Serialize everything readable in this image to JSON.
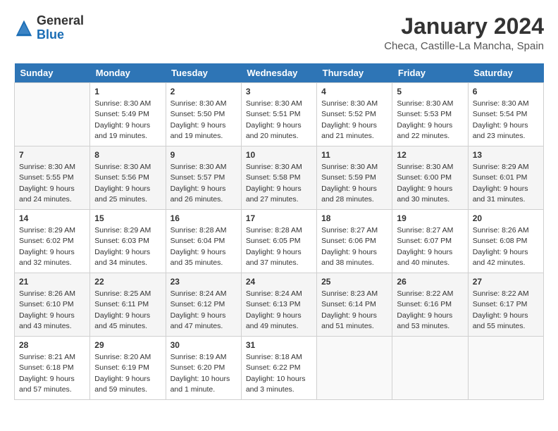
{
  "header": {
    "logo_general": "General",
    "logo_blue": "Blue",
    "month_year": "January 2024",
    "location": "Checa, Castille-La Mancha, Spain"
  },
  "weekdays": [
    "Sunday",
    "Monday",
    "Tuesday",
    "Wednesday",
    "Thursday",
    "Friday",
    "Saturday"
  ],
  "weeks": [
    [
      {
        "day": "",
        "info": ""
      },
      {
        "day": "1",
        "info": "Sunrise: 8:30 AM\nSunset: 5:49 PM\nDaylight: 9 hours\nand 19 minutes."
      },
      {
        "day": "2",
        "info": "Sunrise: 8:30 AM\nSunset: 5:50 PM\nDaylight: 9 hours\nand 19 minutes."
      },
      {
        "day": "3",
        "info": "Sunrise: 8:30 AM\nSunset: 5:51 PM\nDaylight: 9 hours\nand 20 minutes."
      },
      {
        "day": "4",
        "info": "Sunrise: 8:30 AM\nSunset: 5:52 PM\nDaylight: 9 hours\nand 21 minutes."
      },
      {
        "day": "5",
        "info": "Sunrise: 8:30 AM\nSunset: 5:53 PM\nDaylight: 9 hours\nand 22 minutes."
      },
      {
        "day": "6",
        "info": "Sunrise: 8:30 AM\nSunset: 5:54 PM\nDaylight: 9 hours\nand 23 minutes."
      }
    ],
    [
      {
        "day": "7",
        "info": "Sunrise: 8:30 AM\nSunset: 5:55 PM\nDaylight: 9 hours\nand 24 minutes."
      },
      {
        "day": "8",
        "info": "Sunrise: 8:30 AM\nSunset: 5:56 PM\nDaylight: 9 hours\nand 25 minutes."
      },
      {
        "day": "9",
        "info": "Sunrise: 8:30 AM\nSunset: 5:57 PM\nDaylight: 9 hours\nand 26 minutes."
      },
      {
        "day": "10",
        "info": "Sunrise: 8:30 AM\nSunset: 5:58 PM\nDaylight: 9 hours\nand 27 minutes."
      },
      {
        "day": "11",
        "info": "Sunrise: 8:30 AM\nSunset: 5:59 PM\nDaylight: 9 hours\nand 28 minutes."
      },
      {
        "day": "12",
        "info": "Sunrise: 8:30 AM\nSunset: 6:00 PM\nDaylight: 9 hours\nand 30 minutes."
      },
      {
        "day": "13",
        "info": "Sunrise: 8:29 AM\nSunset: 6:01 PM\nDaylight: 9 hours\nand 31 minutes."
      }
    ],
    [
      {
        "day": "14",
        "info": "Sunrise: 8:29 AM\nSunset: 6:02 PM\nDaylight: 9 hours\nand 32 minutes."
      },
      {
        "day": "15",
        "info": "Sunrise: 8:29 AM\nSunset: 6:03 PM\nDaylight: 9 hours\nand 34 minutes."
      },
      {
        "day": "16",
        "info": "Sunrise: 8:28 AM\nSunset: 6:04 PM\nDaylight: 9 hours\nand 35 minutes."
      },
      {
        "day": "17",
        "info": "Sunrise: 8:28 AM\nSunset: 6:05 PM\nDaylight: 9 hours\nand 37 minutes."
      },
      {
        "day": "18",
        "info": "Sunrise: 8:27 AM\nSunset: 6:06 PM\nDaylight: 9 hours\nand 38 minutes."
      },
      {
        "day": "19",
        "info": "Sunrise: 8:27 AM\nSunset: 6:07 PM\nDaylight: 9 hours\nand 40 minutes."
      },
      {
        "day": "20",
        "info": "Sunrise: 8:26 AM\nSunset: 6:08 PM\nDaylight: 9 hours\nand 42 minutes."
      }
    ],
    [
      {
        "day": "21",
        "info": "Sunrise: 8:26 AM\nSunset: 6:10 PM\nDaylight: 9 hours\nand 43 minutes."
      },
      {
        "day": "22",
        "info": "Sunrise: 8:25 AM\nSunset: 6:11 PM\nDaylight: 9 hours\nand 45 minutes."
      },
      {
        "day": "23",
        "info": "Sunrise: 8:24 AM\nSunset: 6:12 PM\nDaylight: 9 hours\nand 47 minutes."
      },
      {
        "day": "24",
        "info": "Sunrise: 8:24 AM\nSunset: 6:13 PM\nDaylight: 9 hours\nand 49 minutes."
      },
      {
        "day": "25",
        "info": "Sunrise: 8:23 AM\nSunset: 6:14 PM\nDaylight: 9 hours\nand 51 minutes."
      },
      {
        "day": "26",
        "info": "Sunrise: 8:22 AM\nSunset: 6:16 PM\nDaylight: 9 hours\nand 53 minutes."
      },
      {
        "day": "27",
        "info": "Sunrise: 8:22 AM\nSunset: 6:17 PM\nDaylight: 9 hours\nand 55 minutes."
      }
    ],
    [
      {
        "day": "28",
        "info": "Sunrise: 8:21 AM\nSunset: 6:18 PM\nDaylight: 9 hours\nand 57 minutes."
      },
      {
        "day": "29",
        "info": "Sunrise: 8:20 AM\nSunset: 6:19 PM\nDaylight: 9 hours\nand 59 minutes."
      },
      {
        "day": "30",
        "info": "Sunrise: 8:19 AM\nSunset: 6:20 PM\nDaylight: 10 hours\nand 1 minute."
      },
      {
        "day": "31",
        "info": "Sunrise: 8:18 AM\nSunset: 6:22 PM\nDaylight: 10 hours\nand 3 minutes."
      },
      {
        "day": "",
        "info": ""
      },
      {
        "day": "",
        "info": ""
      },
      {
        "day": "",
        "info": ""
      }
    ]
  ]
}
